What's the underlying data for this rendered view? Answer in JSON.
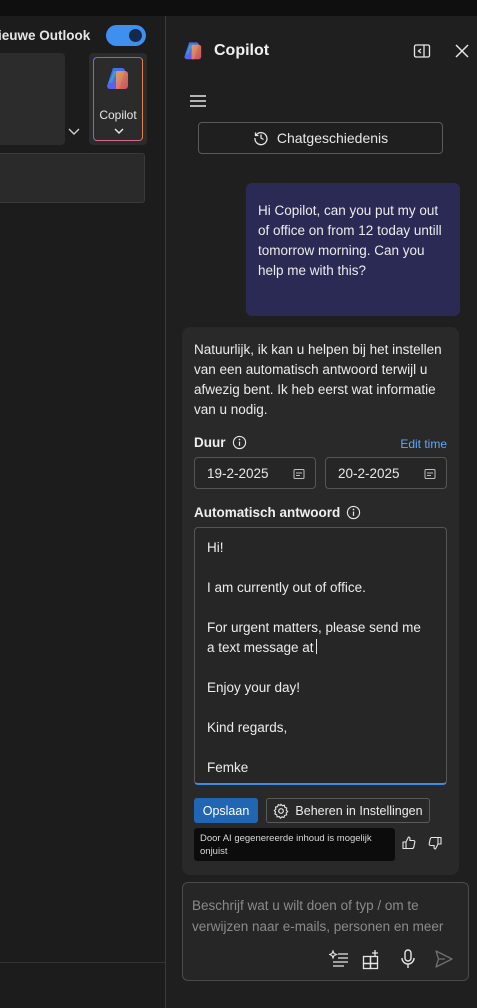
{
  "background_app": {
    "toggle_label": "ieuwe Outlook",
    "toggle_on": true,
    "copilot_tile_label": "Copilot"
  },
  "pane": {
    "title": "Copilot",
    "history_button": "Chatgeschiedenis"
  },
  "user_message": "Hi Copilot, can you put my out of office on from 12 today untill tomorrow morning. Can you help me with this?",
  "ai_response": {
    "intro": "Natuurlijk, ik kan u helpen bij het instellen van een automatisch antwoord terwijl u afwezig bent. Ik heb eerst wat informatie van u nodig.",
    "duration_label": "Duur",
    "edit_time_link": "Edit time",
    "start_date": "19-2-2025",
    "end_date": "20-2-2025",
    "auto_reply_label": "Automatisch antwoord",
    "auto_reply_lines": [
      "Hi!",
      "",
      "I am currently out of office.",
      "",
      "For urgent matters, please send me",
      "a text message at",
      "",
      "Enjoy your day!",
      "",
      "Kind regards,",
      "",
      "Femke"
    ],
    "save_button": "Opslaan",
    "manage_button": "Beheren in Instellingen",
    "disclaimer": "Door AI gegenereerde inhoud is mogelijk onjuist"
  },
  "composer": {
    "placeholder": "Beschrijf wat u wilt doen of typ / om te verwijzen naar e-mails, personen en meer"
  },
  "colors": {
    "accent_blue": "#3f8ff0",
    "user_bubble": "#2a2a55",
    "save_button": "#2166b3",
    "link": "#5aa8ff"
  }
}
